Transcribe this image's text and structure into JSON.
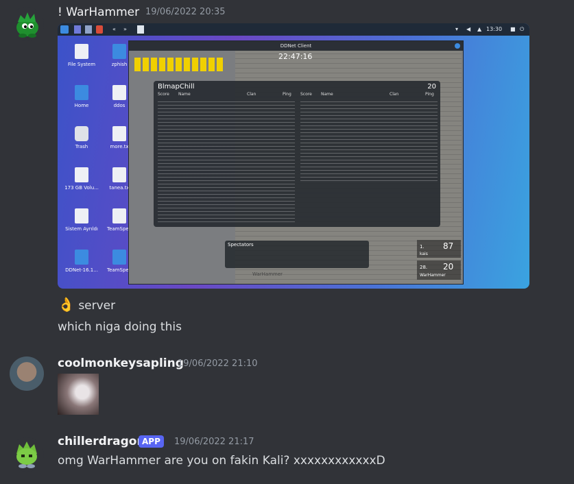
{
  "messages": [
    {
      "username": "! WarHammer",
      "timestamp": "19/06/2022 20:35",
      "lines": [
        "server",
        "which niga doing this"
      ],
      "reaction_emoji": "👌"
    },
    {
      "username": "coolmonkeysapling",
      "timestamp": "19/06/2022 21:10"
    },
    {
      "username": "chillerdragon",
      "badge": "APP",
      "timestamp": "19/06/2022 21:17",
      "lines": [
        "omg WarHammer are you on fakin Kali? xxxxxxxxxxxxD"
      ]
    }
  ],
  "screenshot": {
    "panel": {
      "clock": "13:30"
    },
    "desktop_icons": [
      "File System",
      "zphish",
      "Home",
      "ddos",
      "Trash",
      "more.tx",
      "173 GB Volu...",
      "tanea.tx",
      "Sistem Ayrıldı",
      "TeamSpea",
      "DDNet-16.1...",
      "TeamSpea"
    ],
    "window_title": "DDNet Client",
    "game_timer": "22:47:16",
    "map_name": "BlmapChill",
    "player_count": "20",
    "columns": [
      "Score",
      "Name",
      "Clan",
      "Ping",
      "Score",
      "Name",
      "Clan",
      "Ping"
    ],
    "spectators_label": "Spectators",
    "player_name": "WarHammer",
    "rank1": {
      "rank": "1.",
      "name": "kais",
      "score": "87"
    },
    "rank2": {
      "rank": "28.",
      "name": "WarHammer",
      "score": "20"
    }
  },
  "colors": {
    "background": "#313338",
    "username": "#f2f3f5",
    "timestamp": "#949ba4",
    "badge": "#5865f2"
  }
}
